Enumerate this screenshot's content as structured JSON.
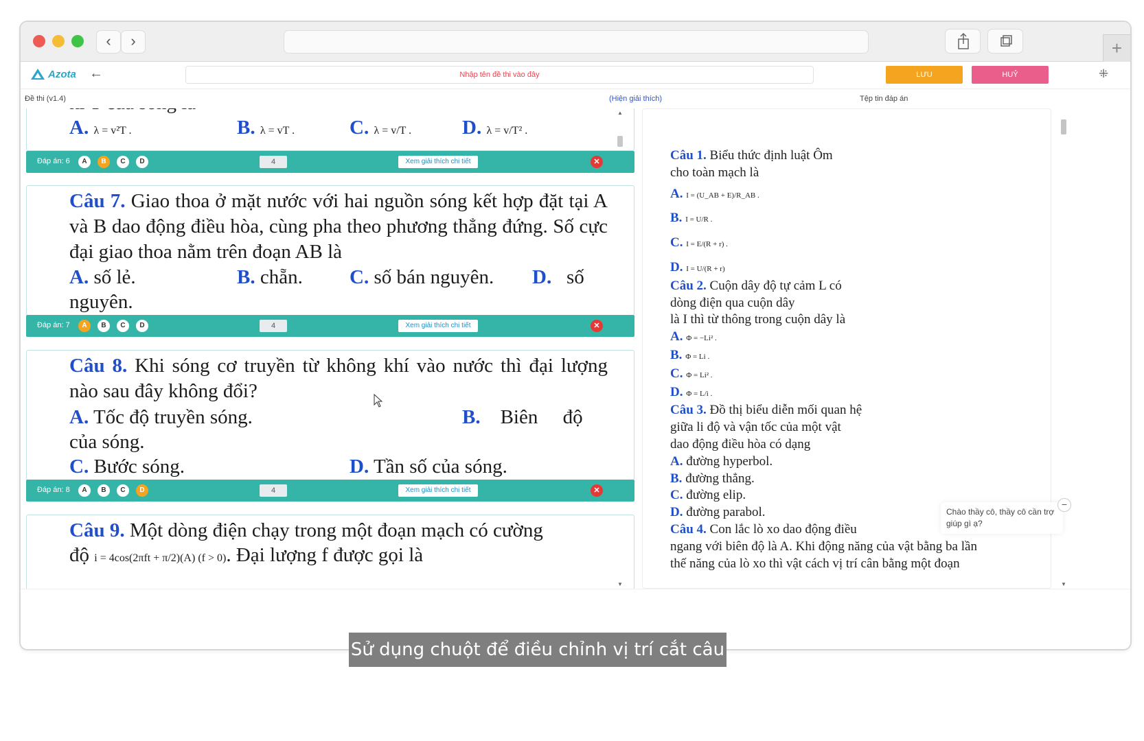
{
  "window": {
    "back_glyph": "‹",
    "forward_glyph": "›",
    "plus_glyph": "+"
  },
  "app": {
    "logo": "Azota",
    "title_placeholder": "Nhập tên đề thi vào đây",
    "save": "LƯU",
    "cancel": "HUỶ"
  },
  "subbar": {
    "left": "Đề thi (v1.4)",
    "center": "(Hiện giải thích)",
    "right": "Tệp tin đáp án"
  },
  "q6": {
    "partial": "kì T của sóng là",
    "a": "A.",
    "a_f": "λ = v²T .",
    "b": "B.",
    "b_f": "λ = vT .",
    "c": "C.",
    "c_f": "λ = v/T .",
    "d": "D.",
    "d_f": "λ = v/T² .",
    "bar": {
      "label": "Đáp án: 6",
      "score": "4",
      "detail": "Xem giải thích chi tiết",
      "selected": "B"
    }
  },
  "q7": {
    "num": "Câu 7.",
    "text": " Giao thoa ở mặt nước với hai nguồn sóng kết hợp đặt tại A và B dao động điều hòa, cùng pha theo phương thẳng đứng. Số cực đại giao thoa nằm trên đoạn AB là",
    "a": "A.",
    "a_t": "số lẻ.",
    "b": "B.",
    "b_t": "chẵn.",
    "c": "C.",
    "c_t": "số bán nguyên.",
    "d": "D.",
    "d_t": "số",
    "d_t2": "nguyên.",
    "bar": {
      "label": "Đáp án: 7",
      "score": "4",
      "detail": "Xem giải thích chi tiết",
      "selected": "A"
    }
  },
  "q8": {
    "num": "Câu 8.",
    "text": " Khi sóng cơ truyền từ không khí vào nước thì đại lượng nào sau đây không đổi?",
    "a": "A.",
    "a_t": "Tốc độ truyền sóng.",
    "b": "B.",
    "b_t": "Biên",
    "b_t2": "độ",
    "b_t3": "của sóng.",
    "c": "C.",
    "c_t": "Bước sóng.",
    "d": "D.",
    "d_t": "Tần số của sóng.",
    "bar": {
      "label": "Đáp án: 8",
      "score": "4",
      "detail": "Xem giải thích chi tiết",
      "selected": "D"
    }
  },
  "q9": {
    "num": "Câu 9.",
    "text": " Một dòng điện chạy trong một đoạn mạch có cường",
    "line2_pre": "độ",
    "formula": "i = 4cos(2πft + π/2)(A)  (f > 0)",
    "line2_post": ". Đại lượng f được gọi là"
  },
  "answer_key": {
    "q1_num": "Câu 1.",
    "q1_text": "Biểu thức định luật Ôm",
    "q1_text2": "cho toàn mạch là",
    "q1_a": "A.",
    "q1_a_f": "I = (U_AB + E)/R_AB .",
    "q1_b": "B.",
    "q1_b_f": "I = U/R .",
    "q1_c": "C.",
    "q1_c_f": "I = E/(R + r) .",
    "q1_d": "D.",
    "q1_d_f": "I = U/(R + r)",
    "q2_num": "Câu 2.",
    "q2_text": "Cuộn dây độ tự cảm L có",
    "q2_text2": "dòng điện qua cuộn dây",
    "q2_text3": "là I thì từ thông trong cuộn dây là",
    "q2_a": "A.",
    "q2_a_f": "Φ = −Li² .",
    "q2_b": "B.",
    "q2_b_f": "Φ = Li .",
    "q2_c": "C.",
    "q2_c_f": "Φ = Li² .",
    "q2_d": "D.",
    "q2_d_f": "Φ = L/i .",
    "q3_num": "Câu 3.",
    "q3_text": "Đồ thị biểu diễn mối quan hệ",
    "q3_text2": "giữa li độ và vận tốc của một vật",
    "q3_text3": "dao động điều hòa có dạng",
    "q3_a": "A.",
    "q3_a_t": "đường hyperbol.",
    "q3_b": "B.",
    "q3_b_t": "đường thẳng.",
    "q3_c": "C.",
    "q3_c_t": "đường elip.",
    "q3_d": "D.",
    "q3_d_t": "đường parabol.",
    "q4_num": "Câu 4.",
    "q4_text": "Con lắc lò xo dao động điều",
    "q4_text2": "ngang với biên độ là A. Khi động năng của vật bằng ba lần",
    "q4_text3": "thế năng của lò xo thì vật cách vị trí cân bằng một đoạn"
  },
  "chat": {
    "text": "Chào thầy cô, thầy cô cần trợ giúp gì ạ?",
    "min": "−"
  },
  "caption": "Sử dụng chuột để điều chỉnh vị trí cắt câu hỏi",
  "colors": {
    "teal": "#35b5a8",
    "blue": "#1f4fcb",
    "orange": "#f4a41e",
    "pink": "#ea5e8c",
    "red": "#e53935"
  }
}
